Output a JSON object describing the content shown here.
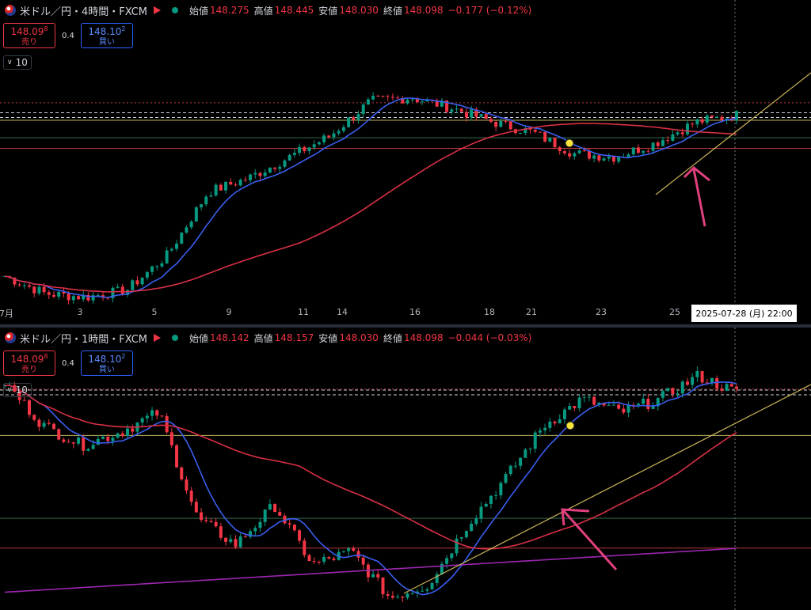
{
  "colors": {
    "up": "#089981",
    "down": "#f23645",
    "ma_short": "#3b5ff0",
    "ma_long": "#d93045",
    "ma_purple": "#9c27b0",
    "trend": "#c9b458",
    "hline_yellow": "#bdb45c",
    "hline_red": "#b83a3a",
    "hline_green": "#2f6b4a",
    "arrow": "#e0407e"
  },
  "top": {
    "legend": {
      "symbol": "米ドル／円・4時間・FXCM",
      "open_label": "始値",
      "open": "148.275",
      "high_label": "高値",
      "high": "148.445",
      "low_label": "安値",
      "low": "148.030",
      "close_label": "終値",
      "close": "148.098",
      "change": "−0.177 (−0.12%)"
    },
    "sell": {
      "price": "148.09",
      "sup": "8",
      "label": "売り"
    },
    "spread": "0.4",
    "buy": {
      "price": "148.10",
      "sup": "2",
      "label": "買い"
    },
    "indicator": "10",
    "xaxis": [
      "7月",
      "3",
      "5",
      "9",
      "11",
      "14",
      "16",
      "18",
      "21",
      "23",
      "25"
    ],
    "crosshair_date": "2025-07-28 (月)   22:00"
  },
  "bottom": {
    "legend": {
      "symbol": "米ドル／円・1時間・FXCM",
      "open_label": "始値",
      "open": "148.142",
      "high_label": "高値",
      "high": "148.157",
      "low_label": "安値",
      "low": "148.030",
      "close_label": "終値",
      "close": "148.098",
      "change": "−0.044 (−0.03%)"
    },
    "sell": {
      "price": "148.09",
      "sup": "8",
      "label": "売り"
    },
    "spread": "0.4",
    "buy": {
      "price": "148.10",
      "sup": "2",
      "label": "買い"
    },
    "indicator": "10"
  },
  "chart_data": [
    {
      "type": "candlestick",
      "title": "米ドル／円・4時間・FXCM",
      "x_ticks": [
        "7月",
        "3",
        "5",
        "9",
        "11",
        "14",
        "16",
        "18",
        "21",
        "23",
        "25"
      ],
      "approx_close_path": [
        143.5,
        143.0,
        142.9,
        143.1,
        144.1,
        145.9,
        146.3,
        146.9,
        147.5,
        148.5,
        148.6,
        148.3,
        147.9,
        147.6,
        147.0,
        146.9,
        147.3,
        147.9,
        148.098
      ],
      "y_range": [
        142.8,
        148.9
      ],
      "horizontal_levels": [
        148.45,
        147.95,
        147.45,
        147.15
      ],
      "moving_averages": [
        "short (blue)",
        "long (red)"
      ]
    },
    {
      "type": "candlestick",
      "title": "米ドル／円・1時間・FXCM",
      "approx_close_path": [
        148.25,
        147.6,
        147.3,
        147.5,
        147.8,
        146.2,
        145.8,
        146.4,
        145.5,
        145.7,
        145.0,
        145.2,
        146.1,
        146.8,
        147.6,
        148.0,
        147.8,
        148.0,
        148.35,
        148.098
      ],
      "y_range": [
        144.9,
        148.6
      ],
      "horizontal_levels": [
        148.15,
        147.45,
        146.2,
        145.75
      ],
      "moving_averages": [
        "short (blue)",
        "long (red)",
        "long (purple)"
      ]
    }
  ]
}
